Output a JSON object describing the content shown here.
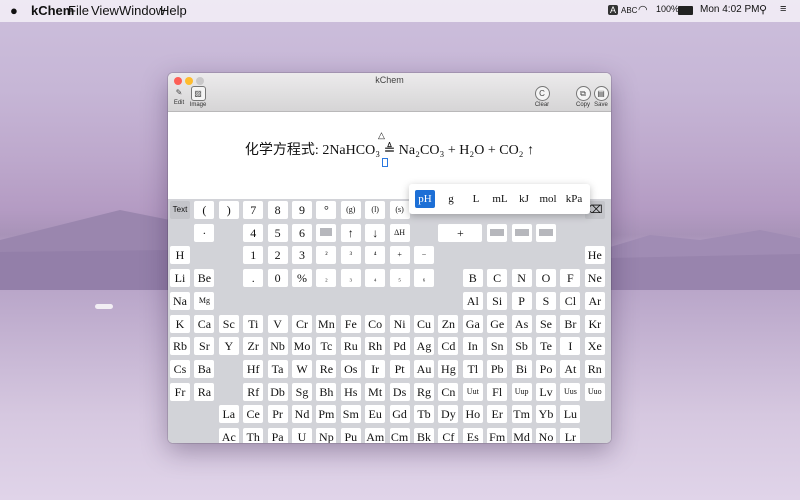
{
  "menubar": {
    "app": "kChem",
    "items": [
      "File",
      "View",
      "Window",
      "Help"
    ],
    "input_source": "A",
    "input_label": "ABC",
    "battery": "100%",
    "clock": "Mon 4:02 PM"
  },
  "window": {
    "title": "kChem",
    "toolbar": {
      "edit": "Edit",
      "image": "Image",
      "clear": "Clear",
      "copy": "Copy",
      "save": "Save"
    }
  },
  "equation": {
    "label": "化学方程式:",
    "text": "2NaHCO₃ ≜ Na₂CO₃ + H₂O + CO₂ ↑",
    "cond_symbol": "△"
  },
  "units": [
    "pH",
    "g",
    "L",
    "mL",
    "kJ",
    "mol",
    "kPa"
  ],
  "selected_unit": "pH",
  "func_rows": [
    [
      "Text",
      "(",
      "",
      ")",
      "",
      "7",
      "8",
      "9",
      "°",
      "(g)",
      "(l)",
      "(s)"
    ],
    [
      "·",
      "4",
      "5",
      "6",
      "",
      "↑",
      "↓",
      "ΔH"
    ],
    [
      "1",
      "2",
      "3",
      "²",
      "³",
      "⁴"
    ],
    [
      ".",
      "0",
      "%",
      "₂",
      "₃",
      "₄",
      "₅",
      "₆"
    ]
  ],
  "plus": "+",
  "elements": {
    "r1": [
      "H",
      "He"
    ],
    "r2": [
      "Li",
      "Be",
      "B",
      "C",
      "N",
      "O",
      "F",
      "Ne"
    ],
    "r3": [
      "Na",
      "Mg",
      "Al",
      "Si",
      "P",
      "S",
      "Cl",
      "Ar"
    ],
    "r4": [
      "K",
      "Ca",
      "Sc",
      "Ti",
      "V",
      "Cr",
      "Mn",
      "Fe",
      "Co",
      "Ni",
      "Cu",
      "Zn",
      "Ga",
      "Ge",
      "As",
      "Se",
      "Br",
      "Kr"
    ],
    "r5": [
      "Rb",
      "Sr",
      "Y",
      "Zr",
      "Nb",
      "Mo",
      "Tc",
      "Ru",
      "Rh",
      "Pd",
      "Ag",
      "Cd",
      "In",
      "Sn",
      "Sb",
      "Te",
      "I",
      "Xe"
    ],
    "r6": [
      "Cs",
      "Ba",
      "Hf",
      "Ta",
      "W",
      "Re",
      "Os",
      "Ir",
      "Pt",
      "Au",
      "Hg",
      "Tl",
      "Pb",
      "Bi",
      "Po",
      "At",
      "Rn"
    ],
    "r7": [
      "Fr",
      "Ra",
      "Rf",
      "Db",
      "Sg",
      "Bh",
      "Hs",
      "Mt",
      "Ds",
      "Rg",
      "Cn",
      "Uut",
      "Fl",
      "Uup",
      "Lv",
      "Uus",
      "Uuo"
    ],
    "lan": [
      "La",
      "Ce",
      "Pr",
      "Nd",
      "Pm",
      "Sm",
      "Eu",
      "Gd",
      "Tb",
      "Dy",
      "Ho",
      "Er",
      "Tm",
      "Yb",
      "Lu"
    ],
    "act": [
      "Ac",
      "Th",
      "Pa",
      "U",
      "Np",
      "Pu",
      "Am",
      "Cm",
      "Bk",
      "Cf",
      "Es",
      "Fm",
      "Md",
      "No",
      "Lr"
    ]
  },
  "colors": {
    "accent": "#1c6fd6",
    "keyboard_bg": "#d2d3d8",
    "key": "#ffffff"
  }
}
